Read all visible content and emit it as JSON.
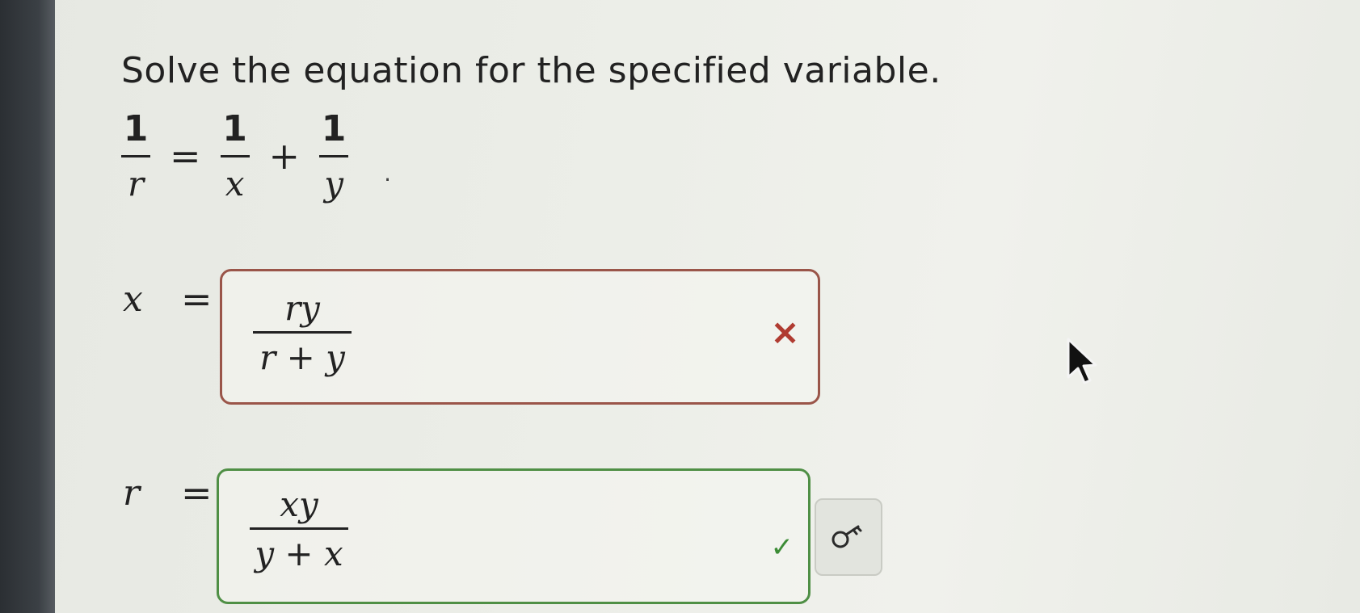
{
  "question": {
    "prompt": "Solve the equation for the specified variable."
  },
  "equation": {
    "lhs_numerator": "1",
    "lhs_denominator": "r",
    "rhs_term1_numerator": "1",
    "rhs_term1_denominator": "x",
    "rhs_term2_numerator": "1",
    "rhs_term2_denominator": "y",
    "equals": "=",
    "plus": "+",
    "period": "."
  },
  "answers": [
    {
      "variable": "x",
      "equals": "=",
      "numerator": "ry",
      "denominator": "r + y",
      "status": "incorrect",
      "status_icon": "x-mark-icon",
      "status_symbol": "×"
    },
    {
      "variable": "r",
      "equals": "=",
      "numerator": "xy",
      "denominator": "y + x",
      "status": "correct",
      "status_icon": "check-icon",
      "status_symbol": "✓"
    }
  ],
  "colors": {
    "incorrect": "#b03b31",
    "correct": "#3c8c36"
  },
  "toolbar": {
    "key_icon": "key-icon"
  }
}
